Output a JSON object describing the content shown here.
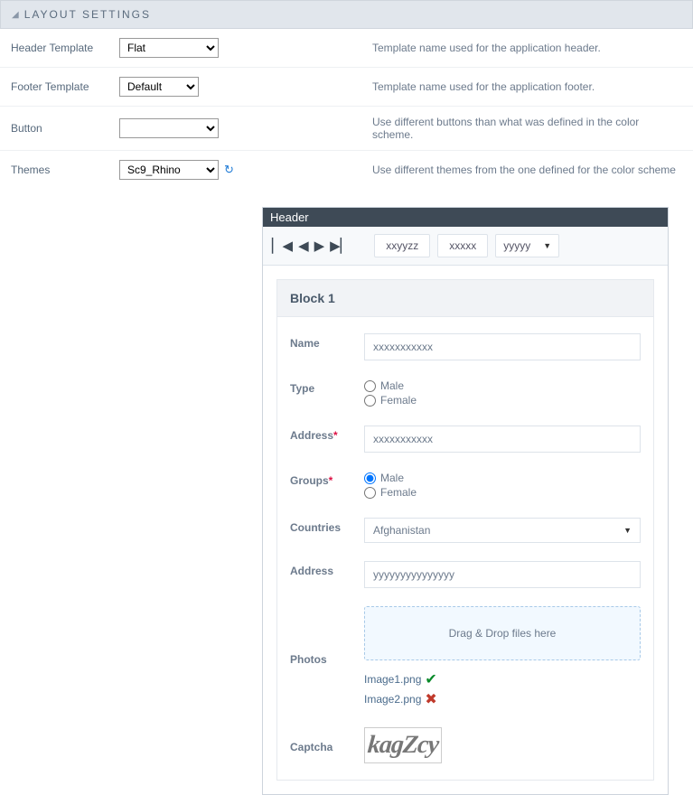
{
  "panel": {
    "title": "LAYOUT SETTINGS"
  },
  "settings": {
    "header_template": {
      "label": "Header Template",
      "value": "Flat",
      "desc": "Template name used for the application header."
    },
    "footer_template": {
      "label": "Footer Template",
      "value": "Default",
      "desc": "Template name used for the application footer."
    },
    "button": {
      "label": "Button",
      "value": "",
      "desc": "Use different buttons than what was defined in the color scheme."
    },
    "themes": {
      "label": "Themes",
      "value": "Sc9_Rhino",
      "desc": "Use different themes from the one defined for the color scheme"
    }
  },
  "preview": {
    "header": "Header",
    "toolbar": {
      "t1": "xxyyzz",
      "t2": "xxxxx",
      "t3": "yyyyy"
    },
    "block_title": "Block 1",
    "form": {
      "name": {
        "label": "Name",
        "value": "xxxxxxxxxxx"
      },
      "type": {
        "label": "Type",
        "opt1": "Male",
        "opt2": "Female"
      },
      "address_req": {
        "label": "Address",
        "value": "xxxxxxxxxxx"
      },
      "groups": {
        "label": "Groups",
        "opt1": "Male",
        "opt2": "Female"
      },
      "countries": {
        "label": "Countries",
        "value": "Afghanistan"
      },
      "address2": {
        "label": "Address",
        "value": "yyyyyyyyyyyyyyy"
      },
      "photos": {
        "label": "Photos",
        "dropzone": "Drag & Drop files here",
        "file1": "Image1.png",
        "file2": "Image2.png"
      },
      "captcha": {
        "label": "Captcha",
        "text": "kagZcy"
      }
    }
  }
}
